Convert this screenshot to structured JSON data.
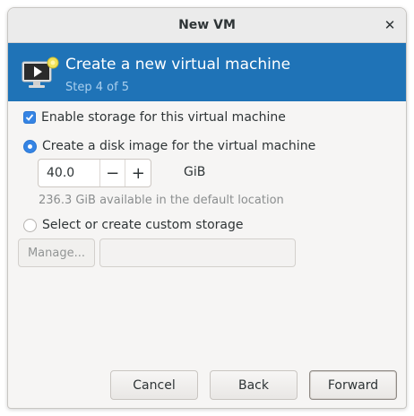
{
  "window": {
    "title": "New VM"
  },
  "banner": {
    "heading": "Create a new virtual machine",
    "step": "Step 4 of 5"
  },
  "storage": {
    "enable_label": "Enable storage for this virtual machine",
    "enable_checked": true,
    "disk_image_label": "Create a disk image for the virtual machine",
    "disk_image_selected": true,
    "size_value": "40.0",
    "size_unit": "GiB",
    "decrement": "−",
    "increment": "+",
    "available_hint": "236.3 GiB available in the default location",
    "custom_label": "Select or create custom storage",
    "custom_selected": false,
    "manage_label": "Manage...",
    "custom_path_value": ""
  },
  "footer": {
    "cancel": "Cancel",
    "back": "Back",
    "forward": "Forward"
  },
  "colors": {
    "banner": "#1f73b7",
    "accent": "#3584e4"
  },
  "icons": {
    "close": "close-icon",
    "vm": "vm-monitor-icon"
  }
}
